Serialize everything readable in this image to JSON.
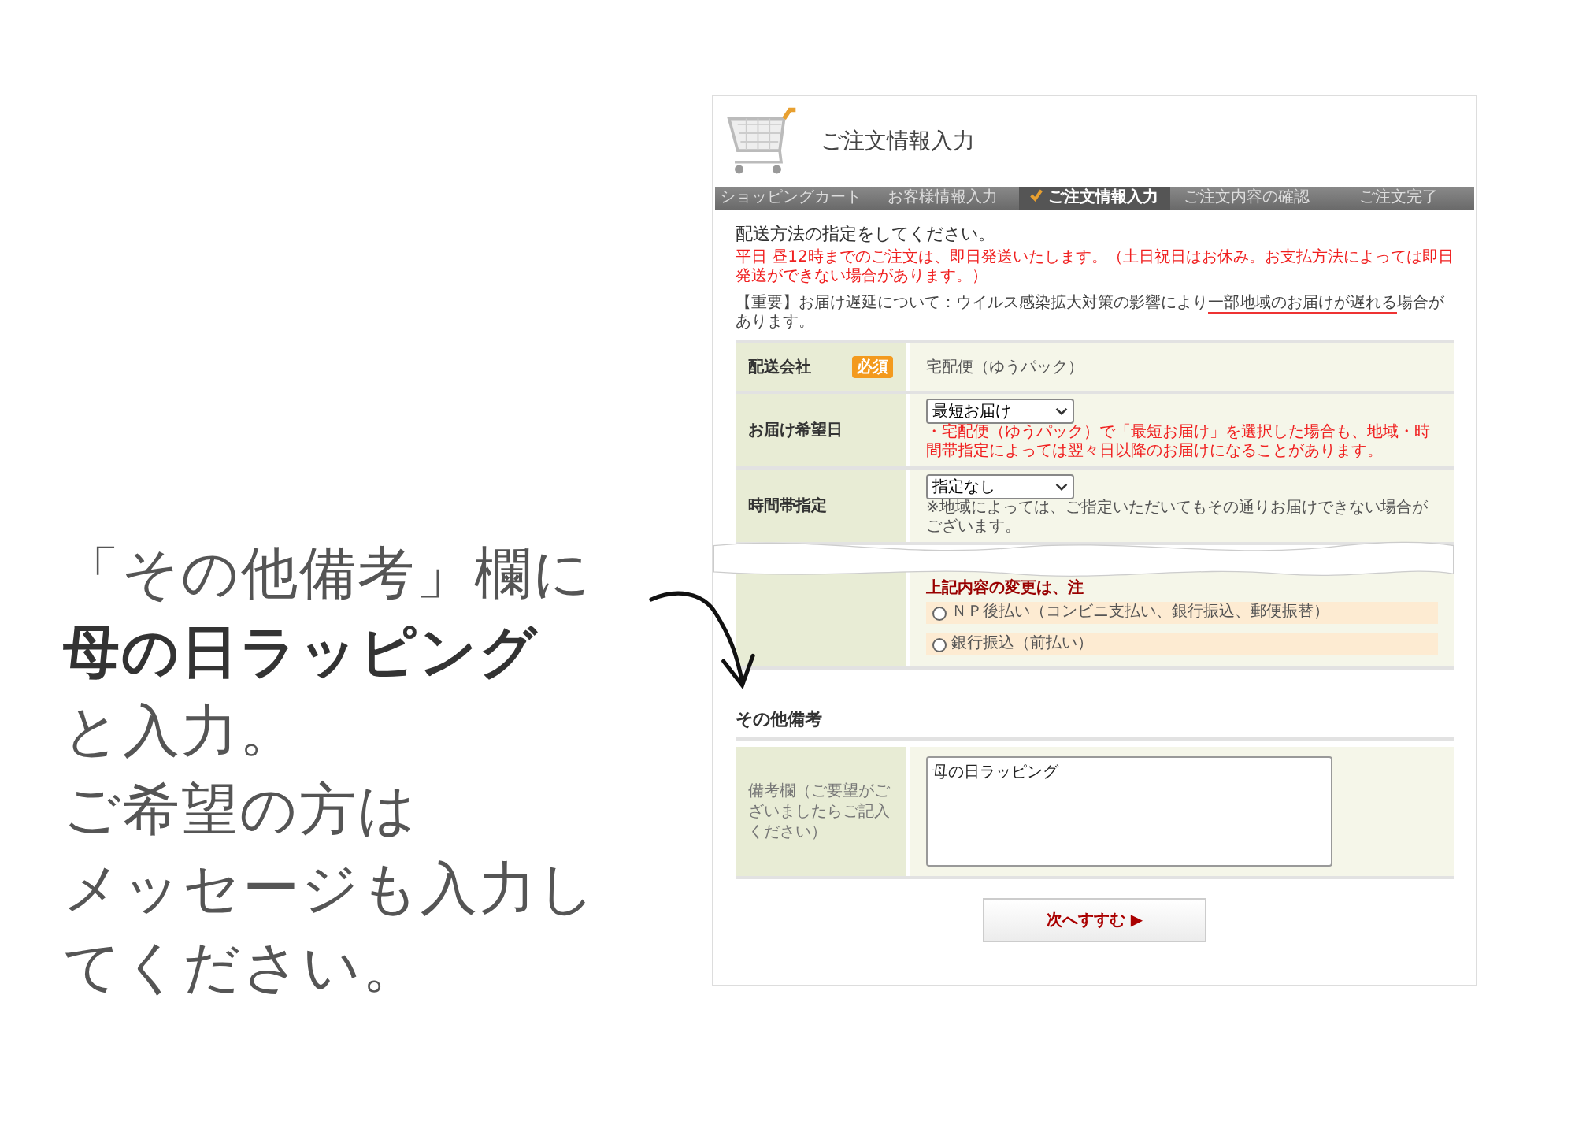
{
  "annotation": [
    {
      "text": "「その他備考」欄に",
      "bold": false
    },
    {
      "text": "母の日ラッピング",
      "bold": true
    },
    {
      "text": "と入力。",
      "bold": false
    },
    {
      "text": "ご希望の方は",
      "bold": false
    },
    {
      "text": "メッセージも入力し",
      "bold": false
    },
    {
      "text": "てください。",
      "bold": false
    }
  ],
  "page": {
    "title": "ご注文情報入力",
    "steps": [
      {
        "label": "ショッピングカート",
        "selected": false
      },
      {
        "label": "お客様情報入力",
        "selected": false
      },
      {
        "label": "ご注文情報入力",
        "selected": true
      },
      {
        "label": "ご注文内容の確認",
        "selected": false
      },
      {
        "label": "ご注文完了",
        "selected": false
      }
    ],
    "heading": "配送方法の指定をしてください。",
    "notice": "平日 昼12時までのご注文は、即日発送いたします。（土日祝日はお休み。お支払方法によっては即日発送ができない場合があります。）",
    "important": [
      {
        "text": "【重要】お届け遅延について：ウイルス感染拡大対策の影響により",
        "underline": false
      },
      {
        "text": "一部地域のお届けが遅れる",
        "underline": true
      },
      {
        "text": "場合があります。",
        "underline": false
      }
    ],
    "rows": [
      {
        "kind": "text",
        "label": "配送会社",
        "badge": "必須",
        "value": "宅配便（ゆうパック）"
      },
      {
        "kind": "select",
        "label": "お届け希望日",
        "value": "最短お届け",
        "note": "・宅配便（ゆうパック）で「最短お届け」を選択した場合も、地域・時間帯指定によっては翌々日以降のお届けになることがあります。",
        "note_red": true
      },
      {
        "kind": "select",
        "label": "時間帯指定",
        "value": "指定なし",
        "note": "※地域によっては、ご指定いただいてもその通りお届けできない場合がございます。",
        "note_red": false
      }
    ],
    "payment": {
      "partial_note": "上記内容の変更は、注",
      "options": [
        {
          "label": "ＮＰ後払い（コンビニ支払い、銀行振込、郵便振替）",
          "selected": false
        },
        {
          "label": "銀行振込（前払い）",
          "selected": false
        }
      ]
    },
    "remarks": {
      "heading": "その他備考",
      "label": "備考欄（ご要望がございましたらご記入ください）",
      "value": "母の日ラッピング"
    },
    "next_button": {
      "label": "次へすすむ",
      "arrow": "▶"
    }
  }
}
